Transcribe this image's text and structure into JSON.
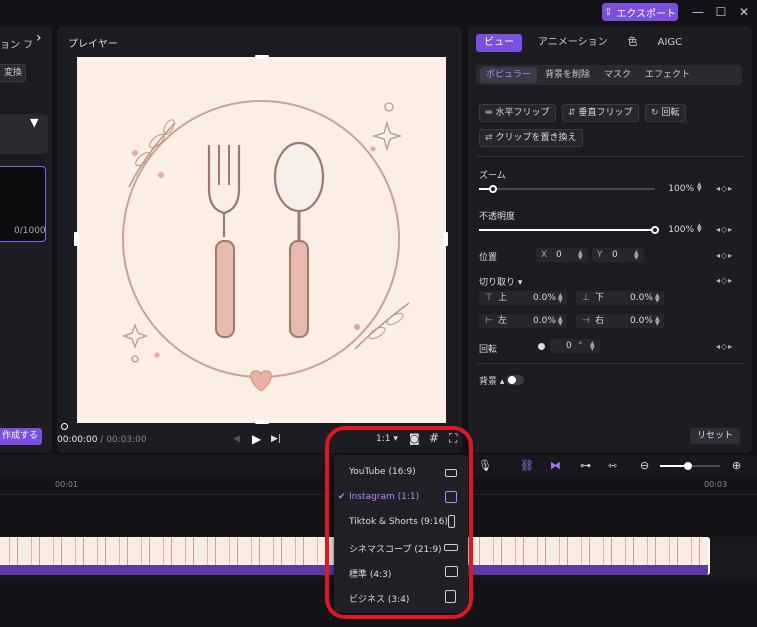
{
  "titlebar": {
    "export_label": "エクスポート",
    "minimize_icon": "—",
    "maximize_icon": "☐",
    "close_icon": "✕"
  },
  "left_panel": {
    "tabs": "ョン フ",
    "convert_label": "変換",
    "char_count": "0/1000",
    "create_label": "作成する"
  },
  "player": {
    "title": "プレイヤー",
    "time_current": "00:00:00",
    "time_total": "/ 00:03:00",
    "ratio_label": "1:1"
  },
  "inspector": {
    "top_tabs": [
      "ビュー",
      "アニメーション",
      "色",
      "AIGC"
    ],
    "sub_tabs": [
      "ポピュラー",
      "背景を削除",
      "マスク",
      "エフェクト"
    ],
    "flip_h": "水平フリップ",
    "flip_v": "垂直フリップ",
    "rotate_btn": "回転",
    "replace_clip": "クリップを置き換え",
    "zoom_label": "ズーム",
    "zoom_value": "100%",
    "zoom_level": 0.08,
    "opacity_label": "不透明度",
    "opacity_value": "100%",
    "opacity_level": 1.0,
    "position_label": "位置",
    "pos_x_label": "X",
    "pos_x": "0",
    "pos_y_label": "Y",
    "pos_y": "0",
    "crop_label": "切り取り",
    "crop_top_label": "上",
    "crop_top": "0.0%",
    "crop_bottom_label": "下",
    "crop_bottom": "0.0%",
    "crop_left_label": "左",
    "crop_left": "0.0%",
    "crop_right_label": "右",
    "crop_right": "0.0%",
    "rotation_label": "回転",
    "rotation_value": "0",
    "rotation_unit": "°",
    "background_label": "背景",
    "reset_label": "リセット"
  },
  "timeline": {
    "tick_1": "00:01",
    "tick_3": "00:03"
  },
  "aspect_menu": {
    "items": [
      {
        "label": "YouTube (16:9)",
        "selected": false
      },
      {
        "label": "Instagram (1:1)",
        "selected": true
      },
      {
        "label": "Tiktok & Shorts (9:16)",
        "selected": false
      },
      {
        "label": "シネマスコープ (21:9)",
        "selected": false
      },
      {
        "label": "標準 (4:3)",
        "selected": false
      },
      {
        "label": "ビジネス (3:4)",
        "selected": false
      }
    ]
  },
  "colors": {
    "accent": "#7b4fe0",
    "accent_text": "#b287ff",
    "highlight": "#e0171f",
    "canvas_bg": "#fbeee4"
  }
}
